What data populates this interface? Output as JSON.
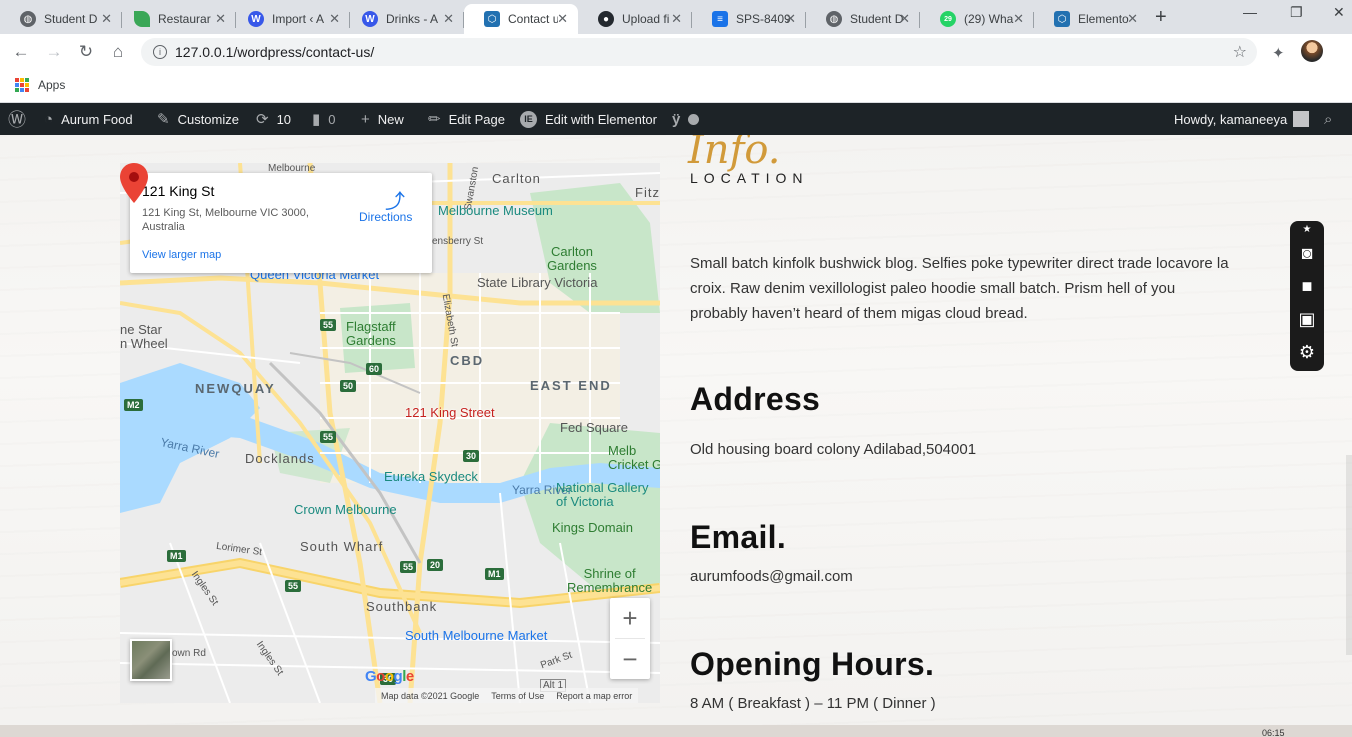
{
  "browser": {
    "tabs": [
      {
        "title": "Student D",
        "color": "#5f6368",
        "icon": "globe-icon"
      },
      {
        "title": "Restaurar",
        "color": "#3aa757",
        "icon": "leaf-icon"
      },
      {
        "title": "Import ‹ A",
        "color": "#3858e9",
        "icon": "wordpress-icon"
      },
      {
        "title": "Drinks - A",
        "color": "#3858e9",
        "icon": "wordpress-icon"
      },
      {
        "title": "Contact u",
        "color": "#2271b1",
        "icon": "hexagon-icon"
      },
      {
        "title": "Upload fi",
        "color": "#24292f",
        "icon": "github-icon"
      },
      {
        "title": "SPS-8409",
        "color": "#1a73e8",
        "icon": "form-icon"
      },
      {
        "title": "Student D",
        "color": "#5f6368",
        "icon": "globe-icon"
      },
      {
        "title": "(29) Wha",
        "color": "#25d366",
        "icon": "whatsapp-icon",
        "badge": "29"
      },
      {
        "title": "Elemento",
        "color": "#2271b1",
        "icon": "hexagon-icon"
      }
    ],
    "url": "127.0.0.1/wordpress/contact-us/",
    "bookmarks_apps": "Apps"
  },
  "adminbar": {
    "site": "Aurum Food",
    "customize": "Customize",
    "updates": "10",
    "comments": "0",
    "new": "New",
    "edit_page": "Edit Page",
    "elementor": "Edit with Elementor",
    "howdy": "Howdy, kamaneeya"
  },
  "map": {
    "place_title": "121 King St",
    "place_address": "121 King St, Melbourne VIC 3000, Australia",
    "directions": "Directions",
    "view_larger": "View larger map",
    "pin_label": "121 King Street",
    "zoom_in": "+",
    "zoom_out": "−",
    "google": "Google",
    "footer_data": "Map data ©2021 Google",
    "footer_terms": "Terms of Use",
    "footer_report": "Report a map error",
    "labels": {
      "carlton": "Carlton",
      "fitz": "Fitz",
      "melbourne_museum": "Melbourne Museum",
      "carlton_gardens": "Carlton Gardens",
      "queen_victoria": "Queen Victoria Market",
      "state_library": "State Library Victoria",
      "flagstaff": "Flagstaff Gardens",
      "cbd": "CBD",
      "east_end": "EAST END",
      "newquay": "NEWQUAY",
      "star_wheel": "ne Star\nn Wheel",
      "yarra_river_w": "Yarra River",
      "yarra_river_e": "Yarra River",
      "docklands": "Docklands",
      "fed_square": "Fed Square",
      "cricket": "Melb\nCricket G",
      "eureka": "Eureka Skydeck",
      "ngv": "National Gallery\nof Victoria",
      "crown": "Crown Melbourne",
      "kings_domain": "Kings Domain",
      "south_wharf": "South Wharf",
      "shrine": "Shrine of\nRemembrance",
      "southbank": "Southbank",
      "south_melbourne_market": "South Melbourne Market",
      "lorimer": "Lorimer St",
      "ingles": "Ingles St",
      "elizabeth": "Elizabeth St",
      "swanston": "Swanston",
      "ensberry": "ensberry St",
      "melbourne_n": "Melbourne",
      "town_rd": "own Rd",
      "park_st": "Park St",
      "alt1": "Alt 1"
    },
    "shields": [
      "55",
      "60",
      "50",
      "55",
      "30",
      "30",
      "M1",
      "M2",
      "M1",
      "20",
      "55",
      "55",
      "30"
    ]
  },
  "info": {
    "script": "Info.",
    "location": "LOCATION",
    "intro": "Small batch kinfolk bushwick blog. Selfies poke typewriter direct trade locavore la croix. Raw denim vexillologist paleo hoodie small batch. Prism hell of you probably haven’t heard of them migas cloud bread.",
    "address_title": "Address",
    "address": "Old housing board colony Adilabad,504001",
    "email_title": "Email.",
    "email": "aurumfoods@gmail.com",
    "hours_title": "Opening Hours.",
    "hours": "8 AM ( Breakfast ) – 11 PM ( Dinner )"
  },
  "taskbar": {
    "clock": "06:15"
  }
}
